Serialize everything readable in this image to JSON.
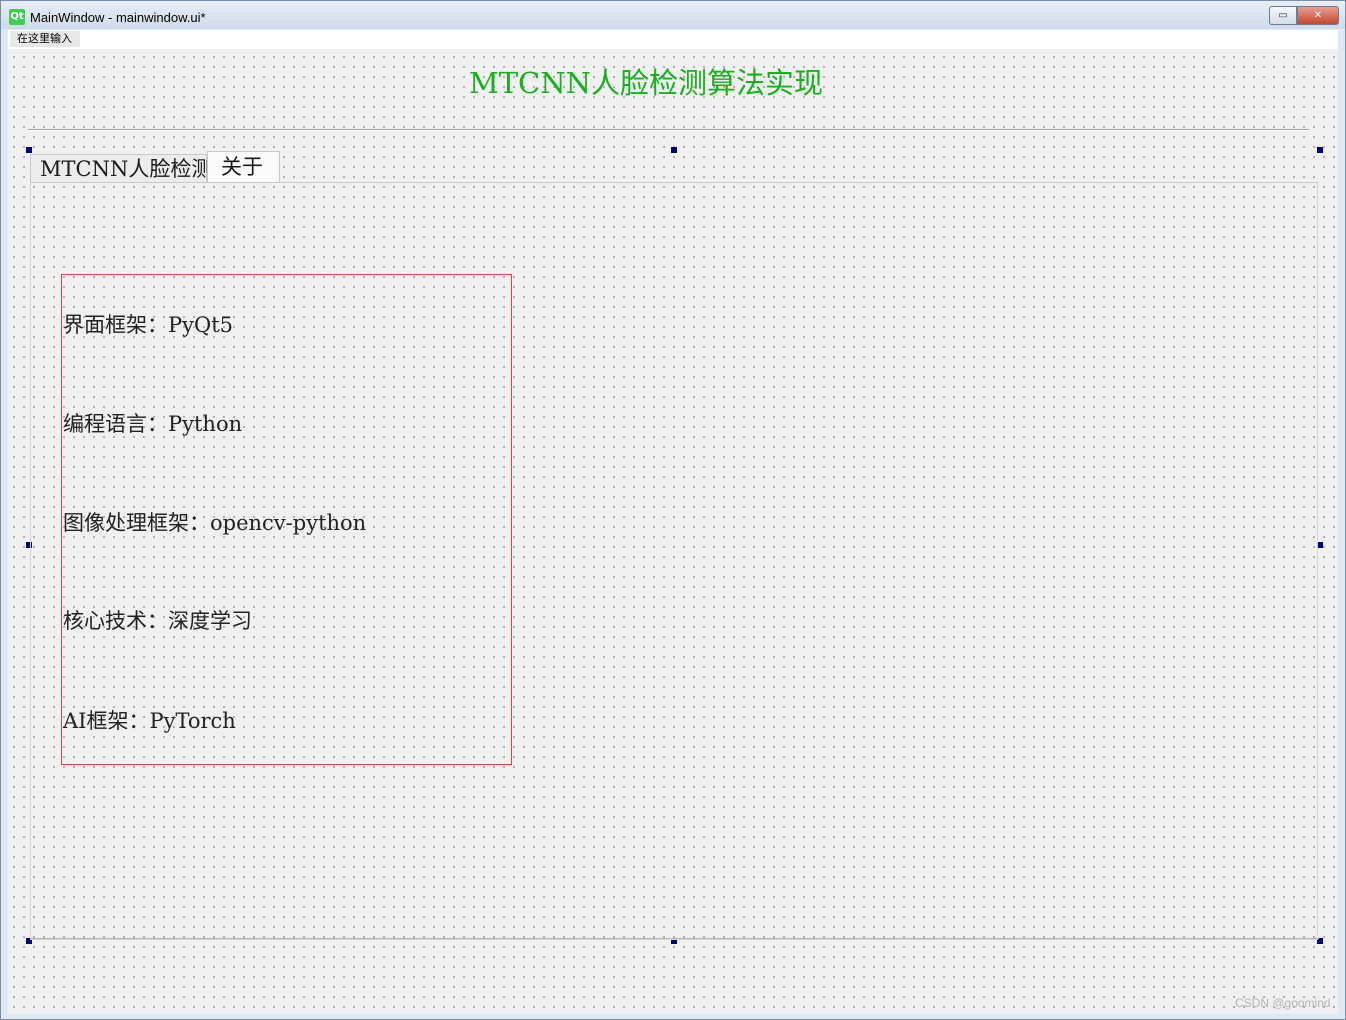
{
  "window": {
    "icon": "qt-logo",
    "icon_text": "Qt",
    "title": "MainWindow - mainwindow.ui*",
    "minimize_symbol": "▭",
    "close_symbol": "✕"
  },
  "menubar": {
    "placeholder_item": "在这里输入"
  },
  "header": {
    "title": "MTCNN人脸检测算法实现",
    "title_color": "#16b21c"
  },
  "tabs": [
    {
      "label": "MTCNN人脸检测",
      "selected": false
    },
    {
      "label": "关于",
      "selected": true
    }
  ],
  "about": {
    "frame_color": "#ee3b3b",
    "lines": [
      "界面框架：PyQt5",
      "编程语言：Python",
      "图像处理框架：opencv-python",
      "核心技术：深度学习",
      "AI框架：PyTorch"
    ]
  },
  "watermark": "CSDN @goomind"
}
